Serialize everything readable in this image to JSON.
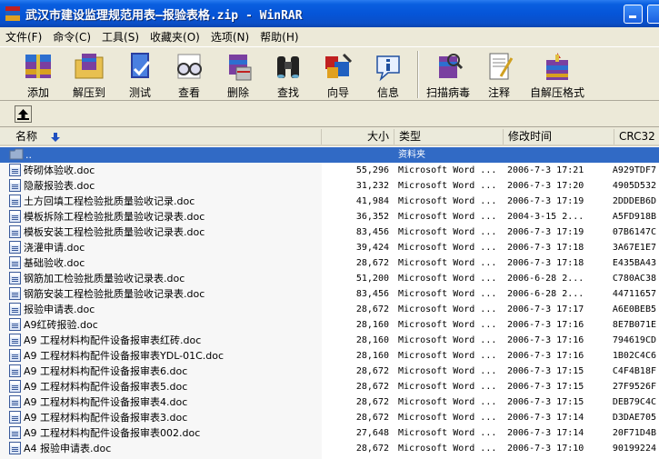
{
  "window": {
    "title": "武汉市建设监理规范用表—报验表格.zip - WinRAR"
  },
  "menu": [
    "文件(F)",
    "命令(C)",
    "工具(S)",
    "收藏夹(O)",
    "选项(N)",
    "帮助(H)"
  ],
  "toolbar": {
    "add": "添加",
    "extract": "解压到",
    "test": "测试",
    "view": "查看",
    "delete": "删除",
    "find": "查找",
    "wizard": "向导",
    "info": "信息",
    "virus": "扫描病毒",
    "comment": "注释",
    "sfx": "自解压格式"
  },
  "columns": {
    "name": "名称",
    "size": "大小",
    "type": "类型",
    "modified": "修改时间",
    "crc": "CRC32"
  },
  "parent_row": {
    "name": "..",
    "type": "资料夹"
  },
  "files": [
    {
      "name": "砖砌体验收.doc",
      "size": "55,296",
      "type": "Microsoft Word ...",
      "modified": "2006-7-3 17:21",
      "crc": "A929TDF7"
    },
    {
      "name": "隐蔽报验表.doc",
      "size": "31,232",
      "type": "Microsoft Word ...",
      "modified": "2006-7-3 17:20",
      "crc": "4905D532"
    },
    {
      "name": "土方回填工程检验批质量验收记录.doc",
      "size": "41,984",
      "type": "Microsoft Word ...",
      "modified": "2006-7-3 17:19",
      "crc": "2DDDEB6D"
    },
    {
      "name": "模板拆除工程检验批质量验收记录表.doc",
      "size": "36,352",
      "type": "Microsoft Word ...",
      "modified": "2004-3-15 2...",
      "crc": "A5FD918B"
    },
    {
      "name": "模板安装工程检验批质量验收记录表.doc",
      "size": "83,456",
      "type": "Microsoft Word ...",
      "modified": "2006-7-3 17:19",
      "crc": "07B6147C"
    },
    {
      "name": "浇灌申请.doc",
      "size": "39,424",
      "type": "Microsoft Word ...",
      "modified": "2006-7-3 17:18",
      "crc": "3A67E1E7"
    },
    {
      "name": "基础验收.doc",
      "size": "28,672",
      "type": "Microsoft Word ...",
      "modified": "2006-7-3 17:18",
      "crc": "E435BA43"
    },
    {
      "name": "钢筋加工检验批质量验收记录表.doc",
      "size": "51,200",
      "type": "Microsoft Word ...",
      "modified": "2006-6-28 2...",
      "crc": "C780AC38"
    },
    {
      "name": "钢筋安装工程检验批质量验收记录表.doc",
      "size": "83,456",
      "type": "Microsoft Word ...",
      "modified": "2006-6-28 2...",
      "crc": "44711657"
    },
    {
      "name": "报验申请表.doc",
      "size": "28,672",
      "type": "Microsoft Word ...",
      "modified": "2006-7-3 17:17",
      "crc": "A6E0BEB5"
    },
    {
      "name": "A9红砖报验.doc",
      "size": "28,160",
      "type": "Microsoft Word ...",
      "modified": "2006-7-3 17:16",
      "crc": "8E7B071E"
    },
    {
      "name": "A9 工程材料构配件设备报审表红砖.doc",
      "size": "28,160",
      "type": "Microsoft Word ...",
      "modified": "2006-7-3 17:16",
      "crc": "794619CD"
    },
    {
      "name": "A9 工程材料构配件设备报审表YDL-01C.doc",
      "size": "28,160",
      "type": "Microsoft Word ...",
      "modified": "2006-7-3 17:16",
      "crc": "1B02C4C6"
    },
    {
      "name": "A9 工程材料构配件设备报审表6.doc",
      "size": "28,672",
      "type": "Microsoft Word ...",
      "modified": "2006-7-3 17:15",
      "crc": "C4F4B18F"
    },
    {
      "name": "A9 工程材料构配件设备报审表5.doc",
      "size": "28,672",
      "type": "Microsoft Word ...",
      "modified": "2006-7-3 17:15",
      "crc": "27F9526F"
    },
    {
      "name": "A9 工程材料构配件设备报审表4.doc",
      "size": "28,672",
      "type": "Microsoft Word ...",
      "modified": "2006-7-3 17:15",
      "crc": "DEB79C4C"
    },
    {
      "name": "A9 工程材料构配件设备报审表3.doc",
      "size": "28,672",
      "type": "Microsoft Word ...",
      "modified": "2006-7-3 17:14",
      "crc": "D3DAE705"
    },
    {
      "name": "A9 工程材料构配件设备报审表002.doc",
      "size": "27,648",
      "type": "Microsoft Word ...",
      "modified": "2006-7-3 17:14",
      "crc": "20F71D4B"
    },
    {
      "name": "A4  报验申请表.doc",
      "size": "28,672",
      "type": "Microsoft Word ...",
      "modified": "2006-7-3 17:10",
      "crc": "90199224"
    }
  ],
  "colors": {
    "titlebar": "#0555d8",
    "selection": "#316ac5",
    "face": "#ece9d8"
  }
}
